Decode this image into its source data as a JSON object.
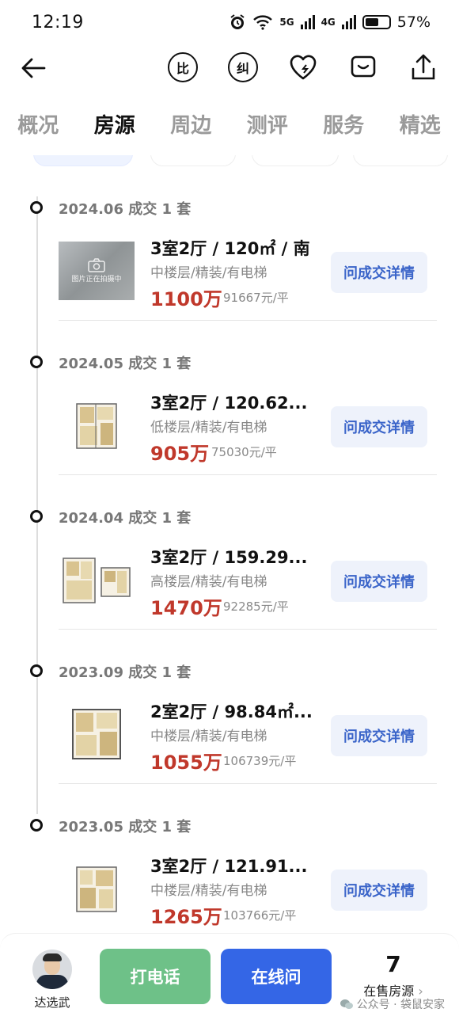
{
  "status_bar": {
    "time": "12:19",
    "battery": "57%",
    "battery_level": 0.57,
    "net1": "5G",
    "net2": "4G"
  },
  "nav": {
    "compare_icon_label": "比",
    "correct_icon_label": "纠"
  },
  "tabs": [
    {
      "label": "概况",
      "active": false
    },
    {
      "label": "房源",
      "active": true
    },
    {
      "label": "周边",
      "active": false
    },
    {
      "label": "测评",
      "active": false
    },
    {
      "label": "服务",
      "active": false
    },
    {
      "label": "精选",
      "active": false
    }
  ],
  "records": [
    {
      "date": "2024.06 成交 1 套",
      "title": "3室2厅 / 120㎡ / 南",
      "sub": "中楼层/精装/有电梯",
      "price": "1100万",
      "unit_price": "91667元/平",
      "photo_text": "图片正在拍摄中",
      "thumb": "photo",
      "button": "问成交详情"
    },
    {
      "date": "2024.05 成交 1 套",
      "title": "3室2厅 / 120.62...",
      "sub": "低楼层/精装/有电梯",
      "price": "905万",
      "unit_price": "75030元/平",
      "thumb": "plan",
      "button": "问成交详情"
    },
    {
      "date": "2024.04 成交 1 套",
      "title": "3室2厅 / 159.29...",
      "sub": "高楼层/精装/有电梯",
      "price": "1470万",
      "unit_price": "92285元/平",
      "thumb": "plan2",
      "button": "问成交详情"
    },
    {
      "date": "2023.09 成交 1 套",
      "title": "2室2厅 / 98.84㎡...",
      "sub": "中楼层/精装/有电梯",
      "price": "1055万",
      "unit_price": "106739元/平",
      "thumb": "plan",
      "button": "问成交详情"
    },
    {
      "date": "2023.05 成交 1 套",
      "title": "3室2厅 / 121.91...",
      "sub": "中楼层/精装/有电梯",
      "price": "1265万",
      "unit_price": "103766元/平",
      "thumb": "plan",
      "button": "问成交详情"
    }
  ],
  "bottom": {
    "agent_name": "达选武",
    "call_label": "打电话",
    "online_label": "在线问",
    "forsale_count": "7",
    "forsale_label": "在售房源",
    "watermark": "公众号 · 袋鼠安家"
  },
  "colors": {
    "price": "#c0382b",
    "call": "#6ec188",
    "online": "#3466e6",
    "ask_text": "#3a64c9"
  }
}
